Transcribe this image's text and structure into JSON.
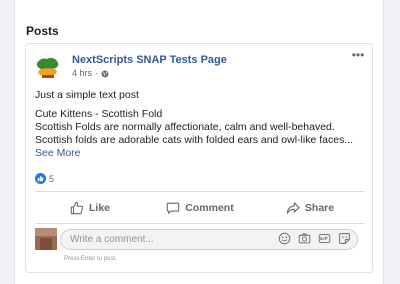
{
  "section": {
    "title": "Posts"
  },
  "post": {
    "page_name": "NextScripts SNAP Tests Page",
    "time": "4 hrs",
    "time_separator": "·",
    "more_label": "•••",
    "text_lines": [
      "Just a simple text post",
      "Cute Kittens - Scottish Fold",
      "Scottish Folds are normally affectionate, calm and well-behaved.",
      "Scottish folds are adorable cats with folded ears and owl-like faces..."
    ],
    "see_more": "See More",
    "reaction_count": "5",
    "actions": {
      "like": "Like",
      "comment": "Comment",
      "share": "Share"
    },
    "comment": {
      "placeholder": "Write a comment...",
      "value": "",
      "hint": "Press Enter to post."
    }
  },
  "icons": {
    "privacy": "globe-icon",
    "reaction": "thumbs-up-icon",
    "like": "thumbs-up-outline-icon",
    "comment": "speech-bubble-icon",
    "share": "share-arrow-icon",
    "emoji": "smiley-icon",
    "photo": "camera-icon",
    "gif": "gif-icon",
    "sticker": "sticker-icon"
  },
  "colors": {
    "page_name": "#365899",
    "link": "#385898",
    "reaction_badge": "#1877f2",
    "secondary_text": "#606770"
  }
}
